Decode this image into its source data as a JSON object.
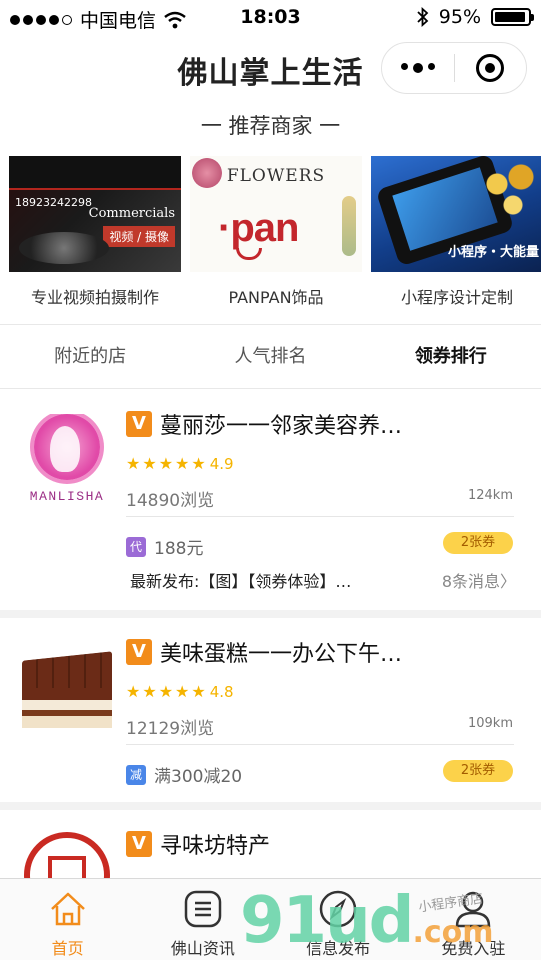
{
  "status_bar": {
    "carrier": "中国电信",
    "time": "18:03",
    "battery": "95%",
    "battery_level": 0.95
  },
  "navbar": {
    "title": "佛山掌上生活"
  },
  "section": {
    "title": "一 推荐商家 一"
  },
  "banners": [
    {
      "caption": "专业视频拍摄制作",
      "en_text": "Commercials",
      "tag_text": "视频 / 摄像",
      "phone_text": "18923242298"
    },
    {
      "caption": "PANPAN饰品",
      "title_text": "FLOWERS",
      "logo_text": "·pan"
    },
    {
      "caption": "小程序设计定制",
      "slogan_text": "小程序・大能量"
    }
  ],
  "tabs": [
    {
      "label": "附近的店",
      "active": false
    },
    {
      "label": "人气排名",
      "active": false
    },
    {
      "label": "领券排行",
      "active": true
    }
  ],
  "shops": [
    {
      "logo_text": "MANLISHA",
      "badge": "V",
      "name": "蔓丽莎一一邻家美容养…",
      "rating": 4.9,
      "rating_text": "4.9",
      "views": "14890浏览",
      "distance": "124km",
      "promo_tag": "代",
      "promo_text": "188元",
      "coupon": "2张券",
      "news": "最新发布:【图】【领券体验】…",
      "news_count": "8条消息〉"
    },
    {
      "badge": "V",
      "name": "美味蛋糕一一办公下午…",
      "rating": 4.8,
      "rating_text": "4.8",
      "views": "12129浏览",
      "distance": "109km",
      "promo_tag": "减",
      "promo_text": "满300减20",
      "coupon": "2张券"
    },
    {
      "badge": "V",
      "name": "寻味坊特产"
    }
  ],
  "tabbar": [
    {
      "label": "首页",
      "icon": "home-icon",
      "active": true
    },
    {
      "label": "佛山资讯",
      "icon": "list-icon",
      "active": false
    },
    {
      "label": "信息发布",
      "icon": "compass-icon",
      "active": false
    },
    {
      "label": "免费入驻",
      "icon": "person-icon",
      "active": false
    }
  ],
  "watermark": {
    "main": "91ud",
    "suffix": ".com",
    "note": "小程序商店"
  },
  "colors": {
    "accent": "#f28c1b",
    "star": "#f5b400",
    "coupon_bg": "#fcd24a"
  }
}
